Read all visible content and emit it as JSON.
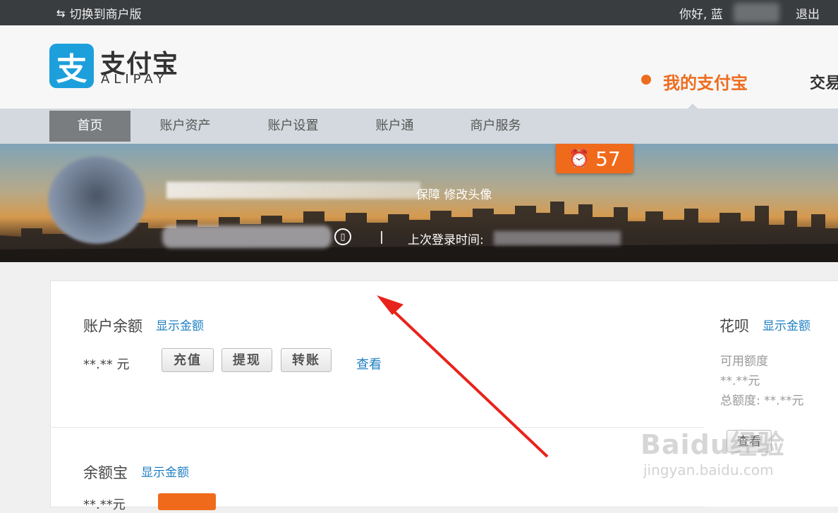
{
  "topbar": {
    "switch_label": "切换到商户版",
    "greeting": "你好, 蓝",
    "logout": "退出"
  },
  "header": {
    "logo_icon_char": "支",
    "logo_cn": "支付宝",
    "logo_en": "ALIPAY",
    "my_alipay": "我的支付宝",
    "trade": "交易",
    "accent_color": "#ed6d1f",
    "brand_color": "#1d9fdc"
  },
  "nav": {
    "items": [
      {
        "label": "首页",
        "active": true
      },
      {
        "label": "账户资产"
      },
      {
        "label": "账户设置"
      },
      {
        "label": "账户通"
      },
      {
        "label": "商户服务"
      }
    ]
  },
  "banner": {
    "protect_text": "保障 修改头像",
    "last_login_label": "上次登录时间:",
    "alarm_count": "57",
    "alarm_icon": "alarm-clock-icon"
  },
  "balance": {
    "title": "账户余额",
    "show_link": "显示金额",
    "amount": "**.** 元",
    "buttons": [
      "充值",
      "提现",
      "转账"
    ],
    "view_link": "查看"
  },
  "yuebao": {
    "title": "余额宝",
    "show_link": "显示金额",
    "amount": "**.**元"
  },
  "huabei": {
    "title": "花呗",
    "show_link": "显示金额",
    "available_label": "可用额度",
    "available_amount": "**.**元",
    "total_label": "总额度: **.**元",
    "view_button": "查看"
  },
  "watermark": {
    "main": "Baidu经验",
    "sub": "jingyan.baidu.com"
  }
}
